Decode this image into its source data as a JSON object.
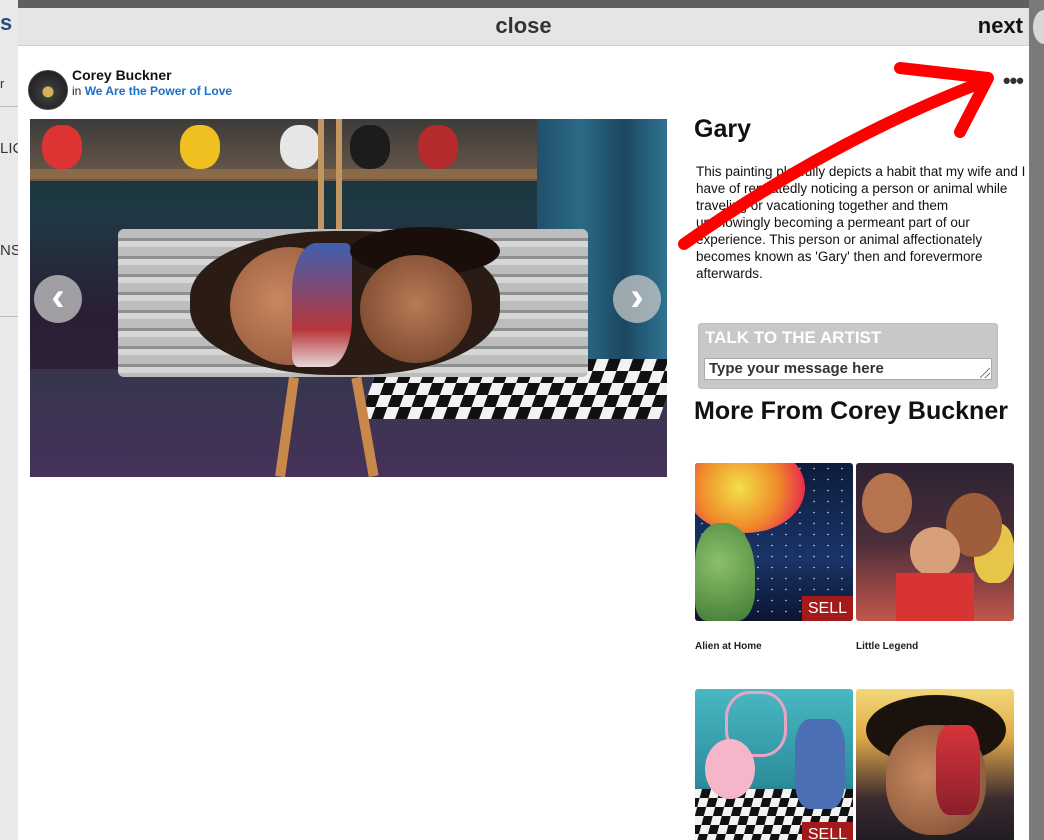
{
  "background_page": {
    "fragments": [
      "s",
      "r",
      "LIC",
      "NS"
    ]
  },
  "modal": {
    "close_label": "close",
    "next_label": "next",
    "more_options": "•••"
  },
  "post": {
    "artist_name": "Corey Buckner",
    "in_prefix": "in",
    "collection": "We Are the Power of Love"
  },
  "artwork": {
    "title": "Gary",
    "description": "This painting playfully depicts a habit that my wife and I have of repeatedly noticing a person or animal while traveling or vacationing together and them unknowingly becoming a permeant part of our experience. This person or animal affectionately becomes known as 'Gary' then and forevermore afterwards.",
    "prev_arrow": "‹",
    "next_arrow": "›"
  },
  "talk": {
    "header": "TALK TO THE ARTIST",
    "placeholder": "Type your message here"
  },
  "more_from": {
    "heading": "More From Corey Buckner",
    "items": [
      {
        "caption": "Alien at Home",
        "badge": "SELL"
      },
      {
        "caption": "Little Legend",
        "badge": ""
      },
      {
        "caption": "",
        "badge": "SELL"
      },
      {
        "caption": "",
        "badge": ""
      }
    ]
  },
  "colors": {
    "link": "#1a6fc4",
    "sell_badge": "#a31a1a",
    "annotation": "#ff0000"
  }
}
